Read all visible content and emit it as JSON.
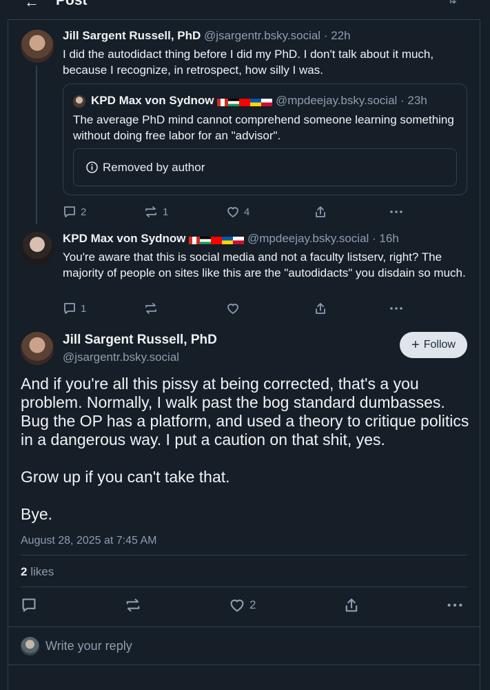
{
  "header": {
    "title": "Post",
    "back_icon": "arrow-left-icon",
    "settings_icon": "sliders-icon"
  },
  "posts": [
    {
      "author": "Jill Sargent Russell, PhD",
      "handle": "@jsargentr.bsky.social",
      "time": "· 22h",
      "text": "I did the autodidact thing before I did my PhD. I don't talk about it much, because I recognize, in retrospect, how silly I was.",
      "quote": {
        "author": "KPD Max von Sydnow",
        "handle": "@mpdeejay.bsky.social",
        "time": "· 23h",
        "text": "The average PhD mind cannot comprehend someone learning something without doing free labor for an \"advisor\".",
        "removed": "Removed by author"
      },
      "replies": "2",
      "reposts": "1",
      "likes": "4"
    },
    {
      "author": "KPD Max von Sydnow",
      "handle": "@mpdeejay.bsky.social",
      "time": "· 16h",
      "text": "You're aware that this is social media and not a faculty listserv, right? The majority of people on sites like this are the \"autodidacts\" you disdain so much.",
      "replies": "1"
    }
  ],
  "focus": {
    "author": "Jill Sargent Russell, PhD",
    "handle": "@jsargentr.bsky.social",
    "follow_label": "Follow",
    "paragraphs": [
      "And if you're all this pissy at being corrected, that's a you problem. Normally, I walk past the bog standard dumbasses. Bug the OP has a platform, and used a theory to critique politics in a dangerous way. I put a caution on that shit, yes.",
      "Grow up if you can't take that.",
      "Bye."
    ],
    "timestamp": "August 28, 2025 at 7:45 AM",
    "likes_count": "2",
    "likes_label": " likes",
    "like_action_count": "2"
  },
  "reply": {
    "placeholder": "Write your reply"
  },
  "colors": {
    "background": "#161e27",
    "border": "#2e4052",
    "muted": "#8d9eb1",
    "follow_bg": "#dfe5eb"
  }
}
